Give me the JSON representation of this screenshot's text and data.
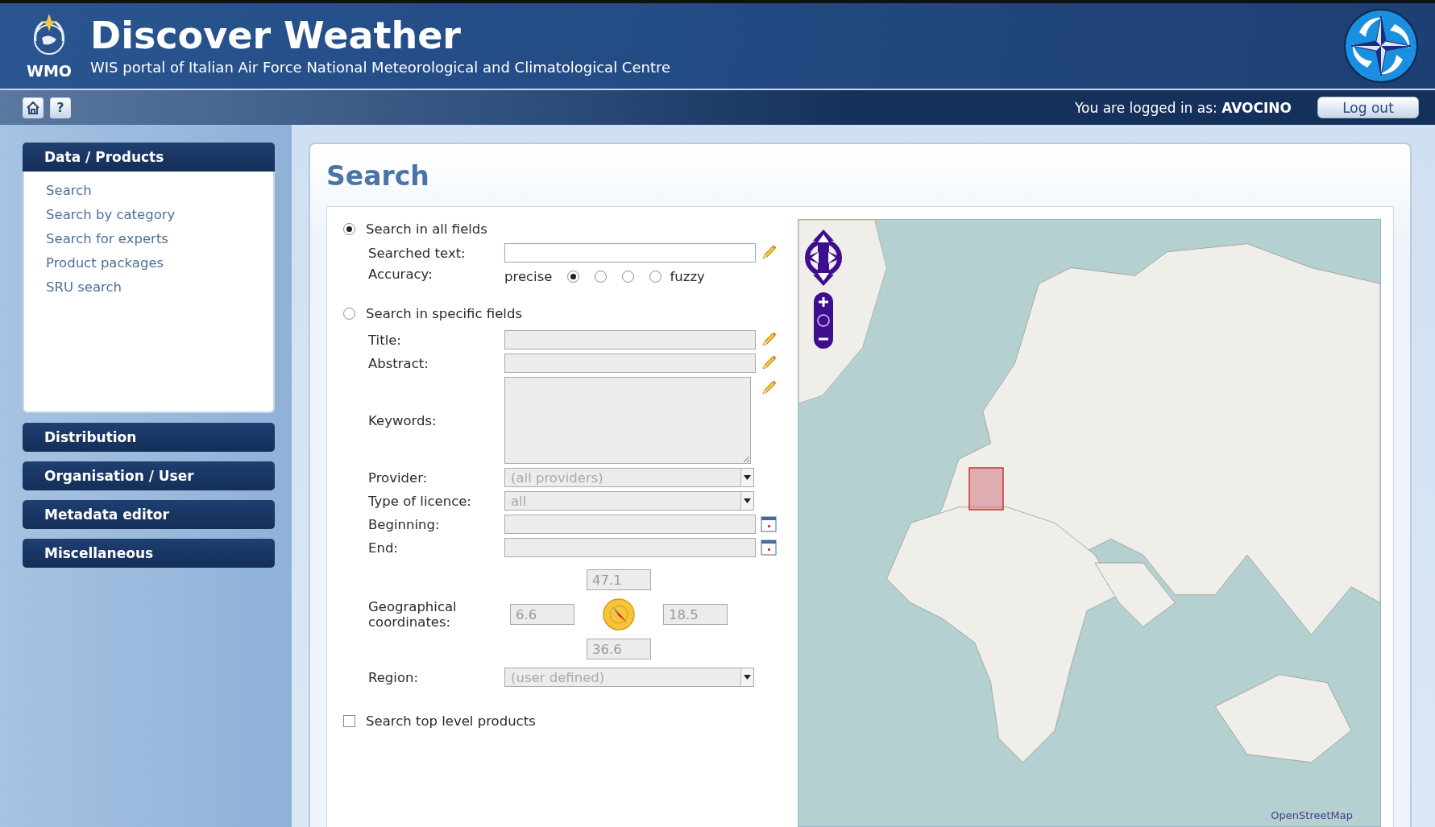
{
  "header": {
    "logo_text": "WMO",
    "title": "Discover Weather",
    "subtitle": "WIS portal of Italian Air Force National Meteorological and Climatological Centre"
  },
  "toolbar": {
    "help_label": "?",
    "login_prefix": "You are logged in as:",
    "user": "AVOCINO",
    "logout": "Log out"
  },
  "sidebar": {
    "sections": [
      {
        "title": "Data / Products",
        "expanded": true,
        "items": [
          "Search",
          "Search by category",
          "Search for experts",
          "Product packages",
          "SRU search"
        ]
      },
      {
        "title": "Distribution",
        "expanded": false
      },
      {
        "title": "Organisation / User",
        "expanded": false
      },
      {
        "title": "Metadata editor",
        "expanded": false
      },
      {
        "title": "Miscellaneous",
        "expanded": false
      }
    ]
  },
  "search": {
    "title": "Search",
    "all_fields": {
      "label": "Search in all fields",
      "selected": true
    },
    "searched_text": {
      "label": "Searched text:",
      "disabled": false
    },
    "accuracy": {
      "label": "Accuracy:",
      "low_label": "precise",
      "high_label": "fuzzy",
      "options": [
        {
          "selected": true
        },
        {
          "selected": false
        },
        {
          "selected": false
        },
        {
          "selected": false
        }
      ]
    },
    "specific_fields": {
      "label": "Search in specific fields",
      "selected": false
    },
    "fields": [
      {
        "kind": "text",
        "label": "Title:",
        "disabled": true
      },
      {
        "kind": "text",
        "label": "Abstract:",
        "disabled": true
      },
      {
        "kind": "textarea",
        "label": "Keywords:",
        "disabled": true
      },
      {
        "kind": "select",
        "label": "Provider:",
        "value": "(all providers)",
        "disabled": true
      },
      {
        "kind": "select",
        "label": "Type of licence:",
        "value": "all",
        "disabled": true
      },
      {
        "kind": "date",
        "label": "Beginning:",
        "disabled": true
      },
      {
        "kind": "date",
        "label": "End:",
        "disabled": true
      }
    ],
    "coordinates": {
      "label": "Geographical coordinates:",
      "north": "47.1",
      "west": "6.6",
      "east": "18.5",
      "south": "36.6",
      "disabled": true
    },
    "region": {
      "label": "Region:",
      "value": "(user defined)",
      "disabled": true
    },
    "top_level": {
      "label": "Search top level products",
      "checked": false
    },
    "map": {
      "attribution": "OpenStreetMap"
    }
  }
}
